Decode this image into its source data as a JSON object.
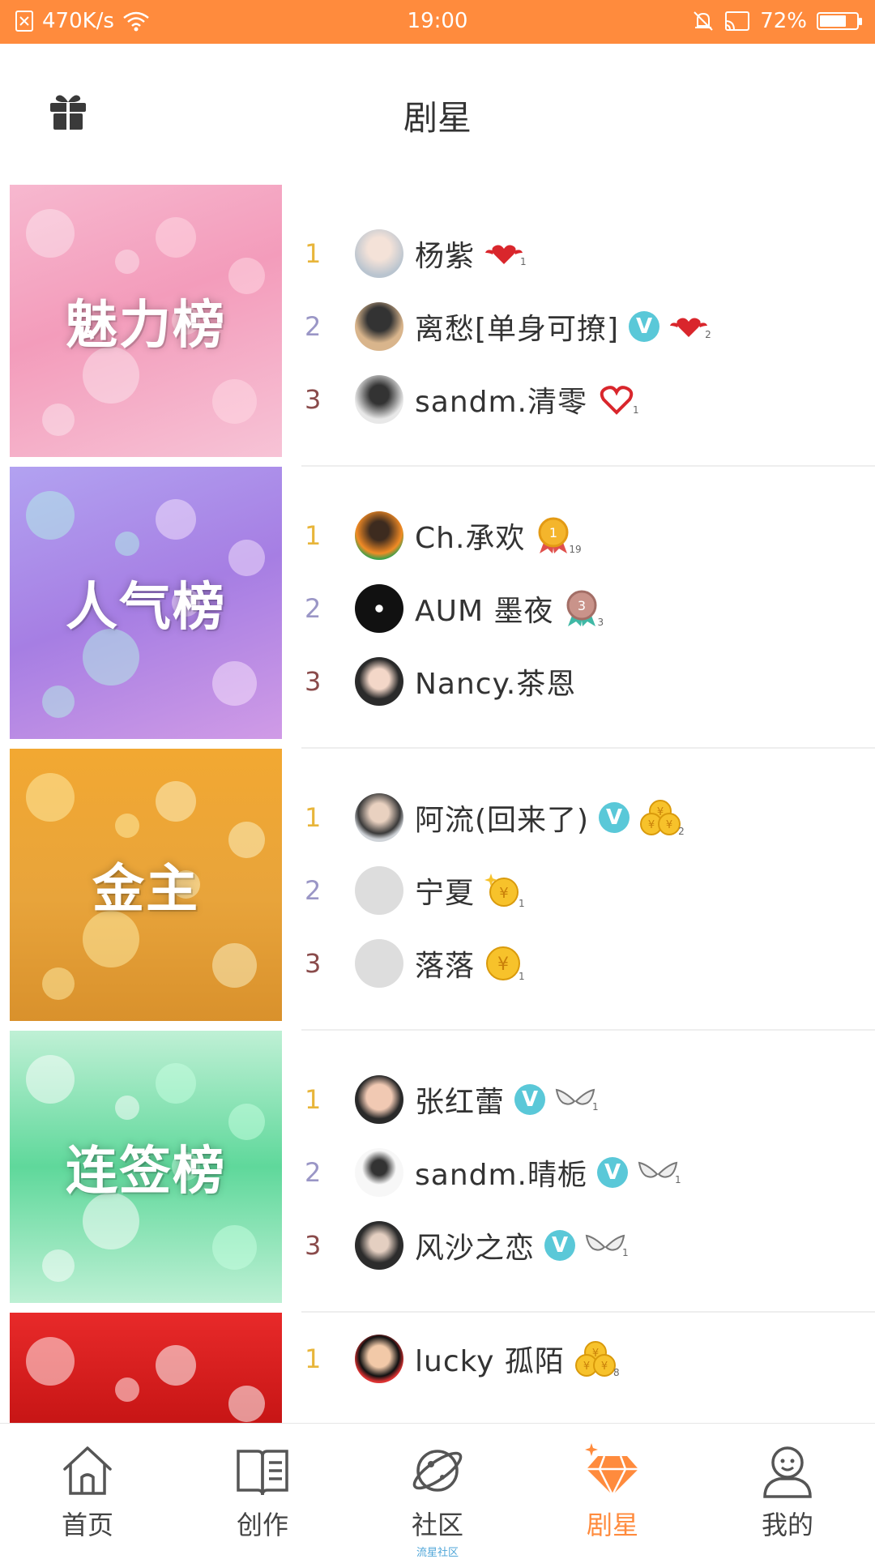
{
  "status_bar": {
    "speed": "470K/s",
    "time": "19:00",
    "battery_level": "72%",
    "battery_fraction": 0.72
  },
  "header": {
    "title": "剧星",
    "gift_icon": "gift-icon"
  },
  "boards": [
    {
      "title": "魅力榜",
      "theme_color": "#F4A6C0",
      "entries": [
        {
          "rank": "1",
          "name": "杨紫",
          "verified": false,
          "badge": "heart-wings-icon",
          "badge_level": "1"
        },
        {
          "rank": "2",
          "name": "离愁[单身可撩]",
          "verified": true,
          "badge": "heart-wings-icon",
          "badge_level": "2"
        },
        {
          "rank": "3",
          "name": "sandm.清零",
          "verified": false,
          "badge": "heart-outline-icon",
          "badge_level": "1"
        }
      ]
    },
    {
      "title": "人气榜",
      "theme_color": "#B79CE6",
      "entries": [
        {
          "rank": "1",
          "name": "Ch.承欢",
          "verified": false,
          "badge": "gold-medal-icon",
          "badge_level": "19"
        },
        {
          "rank": "2",
          "name": "AUM 墨夜",
          "verified": false,
          "badge": "bronze-medal-icon",
          "badge_level": "3"
        },
        {
          "rank": "3",
          "name": "Nancy.茶恩",
          "verified": false,
          "badge": "",
          "badge_level": ""
        }
      ]
    },
    {
      "title": "金主",
      "theme_color": "#E9A83A",
      "entries": [
        {
          "rank": "1",
          "name": "阿流(回来了)",
          "verified": true,
          "badge": "coin-stack-icon",
          "badge_level": "2"
        },
        {
          "rank": "2",
          "name": "宁夏",
          "verified": false,
          "badge": "coin-sparkle-icon",
          "badge_level": "1"
        },
        {
          "rank": "3",
          "name": "落落",
          "verified": false,
          "badge": "coin-icon",
          "badge_level": "1"
        }
      ]
    },
    {
      "title": "连签榜",
      "theme_color": "#5ED59A",
      "entries": [
        {
          "rank": "1",
          "name": "张红蕾",
          "verified": true,
          "badge": "wings-icon",
          "badge_level": "1"
        },
        {
          "rank": "2",
          "name": "sandm.晴栀",
          "verified": true,
          "badge": "wings-icon",
          "badge_level": "1"
        },
        {
          "rank": "3",
          "name": "风沙之恋",
          "verified": true,
          "badge": "wings-icon",
          "badge_level": "1"
        }
      ]
    },
    {
      "title": "",
      "theme_color": "#E02525",
      "entries": [
        {
          "rank": "1",
          "name": "lucky 孤陌",
          "verified": false,
          "badge": "coin-stack-icon",
          "badge_level": "8"
        }
      ]
    }
  ],
  "verified_mark": "V",
  "bottom_nav": {
    "items": [
      {
        "label": "首页",
        "icon": "home-icon",
        "active": false
      },
      {
        "label": "创作",
        "icon": "book-icon",
        "active": false
      },
      {
        "label": "社区",
        "icon": "planet-icon",
        "active": false,
        "sub": "流星社区"
      },
      {
        "label": "剧星",
        "icon": "diamond-icon",
        "active": true
      },
      {
        "label": "我的",
        "icon": "user-icon",
        "active": false
      }
    ],
    "active_color": "#FF8B3D"
  }
}
